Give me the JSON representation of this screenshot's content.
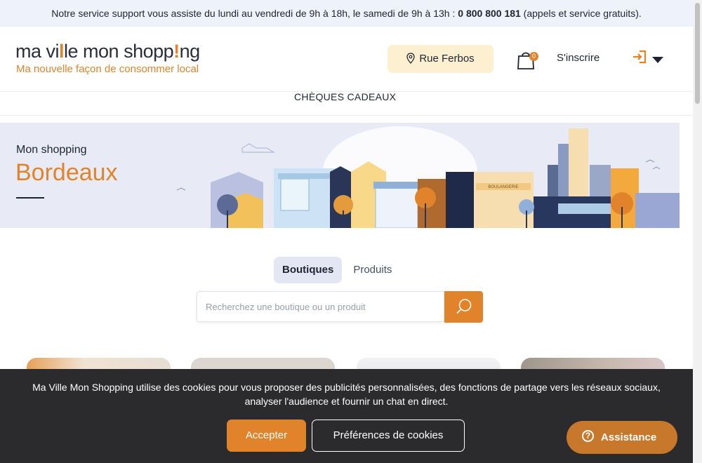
{
  "topbar": {
    "text_before": "Notre service support vous assiste du lundi au vendredi de 9h à 18h, le samedi de 9h à 13h : ",
    "phone": "0 800 800 181",
    "text_after": " (appels et service gratuits)."
  },
  "header": {
    "logo_part1": "ma vi",
    "logo_accent1": "l",
    "logo_part2": "le mon shopp",
    "logo_accent2": "!",
    "logo_part3": "ng",
    "tagline": "Ma nouvelle façon de consommer local",
    "location_label": "Rue Ferbos",
    "cart_count": "0",
    "signup_label": "S'inscrire"
  },
  "nav": {
    "gift_cards": "CHÈQUES CADEAUX"
  },
  "hero": {
    "subtitle": "Mon shopping",
    "city": "Bordeaux",
    "shop_sign_1": "BOULANGERIE"
  },
  "search": {
    "tabs": [
      {
        "label": "Boutiques",
        "active": true
      },
      {
        "label": "Produits",
        "active": false
      }
    ],
    "placeholder": "Recherchez une boutique ou un produit"
  },
  "cookie": {
    "message": "Ma Ville Mon Shopping utilise des cookies pour vous proposer des publicités personnalisées, des fonctions de partage vers les réseaux sociaux, analyser l'audience et fournir un chat en direct.",
    "accept_label": "Accepter",
    "preferences_label": "Préférences de cookies"
  },
  "assistance": {
    "label": "Assistance",
    "icon": "question-icon"
  },
  "colors": {
    "accent": "#e0832a",
    "dark": "#2b2b2e",
    "hero_bg": "#e8ebf6",
    "location_bg": "#fdf0d1"
  }
}
